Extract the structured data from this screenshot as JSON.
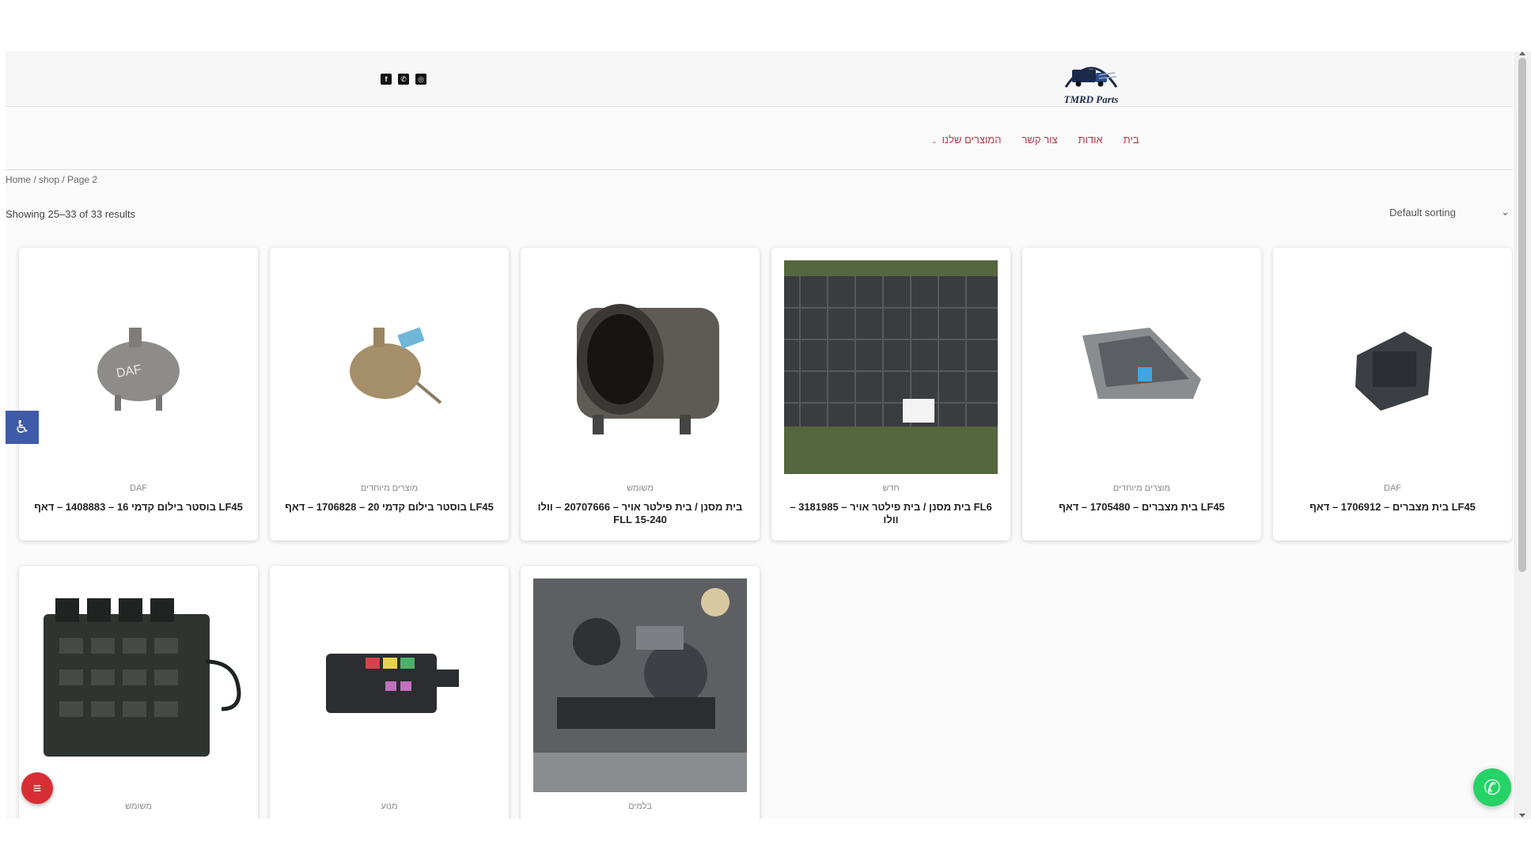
{
  "brand": {
    "name": "TMRD Parts"
  },
  "social": [
    {
      "name": "facebook-icon",
      "glyph": "f"
    },
    {
      "name": "whatsapp-icon",
      "glyph": "w"
    },
    {
      "name": "instagram-icon",
      "glyph": "o"
    }
  ],
  "nav": {
    "home": "בית",
    "about": "אודות",
    "contact": "צור קשר",
    "products": "המוצרים שלנו"
  },
  "breadcrumb": "Home / shop / Page 2",
  "result_count": "Showing 25–33 of 33 results",
  "sorting": {
    "selected": "Default sorting"
  },
  "products": [
    {
      "category": "DAF",
      "title": "LF45 בית מצברים – 1706912 – דאף"
    },
    {
      "category": "מוצרים מיוחדים",
      "title": "LF45 בית מצברים – 1705480 – דאף"
    },
    {
      "category": "חדש",
      "title": "FL6 בית מסנן / בית פילטר אויר – 3181985 – וולו"
    },
    {
      "category": "משומש",
      "title": "בית מסנן / בית פילטר אויר – 20707666 – וולו FLL 15-240"
    },
    {
      "category": "מוצרים מיוחדים",
      "title": "LF45 בוסטר בילום קדמי 20 – 1706828 – דאף"
    },
    {
      "category": "DAF",
      "title": "LF45 בוסטר בילום קדמי 16 – 1408883 – דאף"
    },
    {
      "category": "בלמים",
      "title": ""
    },
    {
      "category": "מנוע",
      "title": ""
    },
    {
      "category": "משומש",
      "title": ""
    }
  ],
  "colors": {
    "accent": "#b23a48",
    "whatsapp": "#25d366",
    "menu_fab": "#d92d35",
    "accessibility": "#3f5aa8"
  }
}
